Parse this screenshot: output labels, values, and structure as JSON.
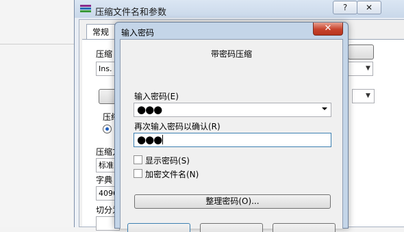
{
  "parent_window": {
    "title": "压缩文件名和参数",
    "help_button": "?",
    "close_button": "✕",
    "tab_general": "常规",
    "labels": {
      "archive_name": "压缩",
      "filename_value": "Ins.",
      "compression_format": "压缩",
      "compression_method": "压缩方",
      "method_value": "标准",
      "dictionary_size": "字典",
      "dictionary_value": "4096",
      "split_volumes": "切分为"
    }
  },
  "dialog": {
    "title": "输入密码",
    "close_icon": "✕",
    "heading": "带密码压缩",
    "password_label": "输入密码(E)",
    "password_value": "●●●",
    "confirm_label": "再次输入密码以确认(R)",
    "confirm_value": "●●●",
    "show_password": "显示密码(S)",
    "encrypt_filenames": "加密文件名(N)",
    "organize_button": "整理密码(O)..."
  }
}
